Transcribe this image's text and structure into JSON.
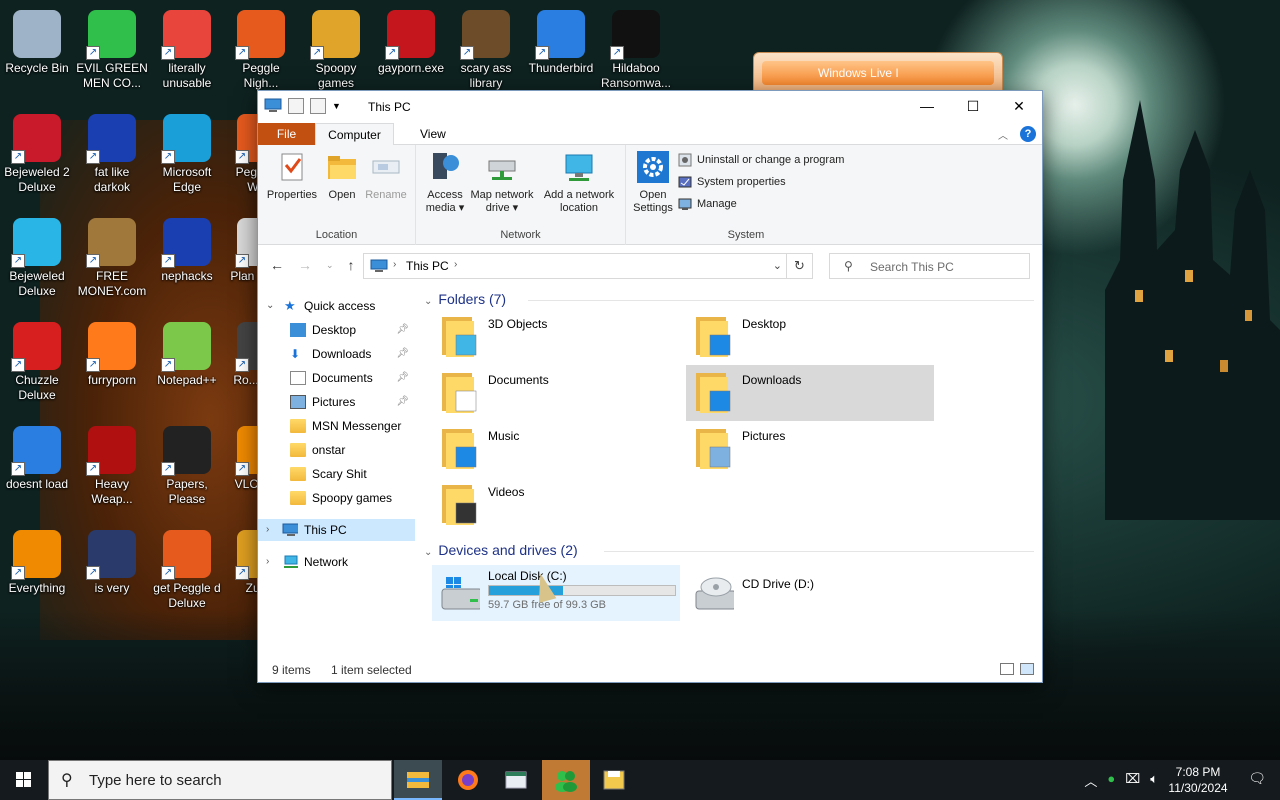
{
  "desktop": {
    "icons": [
      {
        "label": "Recycle Bin",
        "icon": "recycle-bin-icon"
      },
      {
        "label": "EVIL GREEN MEN CO...",
        "icon": "msn-messenger-icon"
      },
      {
        "label": "literally unusable",
        "icon": "chrome-icon"
      },
      {
        "label": "Peggle Nigh...",
        "icon": "peggle-icon"
      },
      {
        "label": "Spoopy games",
        "icon": "folder-icon"
      },
      {
        "label": "gayporn.exe",
        "icon": "flash-icon"
      },
      {
        "label": "scary ass library",
        "icon": "library-icon"
      },
      {
        "label": "Thunderbird",
        "icon": "thunderbird-icon"
      },
      {
        "label": "Hildaboo Ransomwa...",
        "icon": "yashma-icon"
      },
      {
        "label": "Bejeweled 2 Deluxe",
        "icon": "bejeweled2-icon"
      },
      {
        "label": "fat like darkok",
        "icon": "mpi-icon"
      },
      {
        "label": "Microsoft Edge",
        "icon": "edge-icon"
      },
      {
        "label": "Peggle of Wa...",
        "icon": "peggle-icon"
      },
      {
        "label": "Bejeweled Deluxe",
        "icon": "gem-icon"
      },
      {
        "label": "FREE MONEY.com",
        "icon": "money-bag-icon"
      },
      {
        "label": "nephacks",
        "icon": "mpi-icon"
      },
      {
        "label": "Plan Zom...",
        "icon": "flower-icon"
      },
      {
        "label": "Chuzzle Deluxe",
        "icon": "chuzzle-icon"
      },
      {
        "label": "furryporn",
        "icon": "firefox-icon"
      },
      {
        "label": "Notepad++",
        "icon": "notepadpp-icon"
      },
      {
        "label": "Ro... Ma...",
        "icon": "app-icon"
      },
      {
        "label": "doesnt load",
        "icon": "thunderbird-icon"
      },
      {
        "label": "Heavy Weap...",
        "icon": "radiation-icon"
      },
      {
        "label": "Papers, Please",
        "icon": "papers-please-icon"
      },
      {
        "label": "VLC pla...",
        "icon": "vlc-icon"
      },
      {
        "label": "Everything",
        "icon": "everything-search-icon"
      },
      {
        "label": "is very",
        "icon": "mpi-shield-icon"
      },
      {
        "label": "get Peggle d Deluxe",
        "icon": "peggle-icon"
      },
      {
        "label": "Zuma",
        "icon": "zuma-icon"
      }
    ],
    "popup_title": "Windows Live I"
  },
  "window": {
    "title": "This PC",
    "tabs": {
      "file": "File",
      "computer": "Computer",
      "view": "View"
    },
    "ribbon": {
      "location": {
        "label": "Location",
        "properties": "Properties",
        "open": "Open",
        "rename": "Rename"
      },
      "network": {
        "label": "Network",
        "access_media_1": "Access",
        "access_media_2": "media",
        "map_drive_1": "Map network",
        "map_drive_2": "drive",
        "add_location_1": "Add a network",
        "add_location_2": "location"
      },
      "system": {
        "label": "System",
        "open_settings_1": "Open",
        "open_settings_2": "Settings",
        "uninstall": "Uninstall or change a program",
        "system_properties": "System properties",
        "manage": "Manage"
      }
    },
    "address": {
      "path": "This PC",
      "search_placeholder": "Search This PC"
    },
    "nav": {
      "quick_access": "Quick access",
      "items": [
        "Desktop",
        "Downloads",
        "Documents",
        "Pictures",
        "MSN Messenger",
        "onstar",
        "Scary Shit",
        "Spoopy games"
      ],
      "this_pc": "This PC",
      "network": "Network"
    },
    "folders_header": "Folders (7)",
    "folders": [
      "3D Objects",
      "Desktop",
      "Documents",
      "Downloads",
      "Music",
      "Pictures",
      "Videos"
    ],
    "devices_header": "Devices and drives (2)",
    "drives": {
      "c_name": "Local Disk (C:)",
      "c_free": "59.7 GB free of 99.3 GB",
      "c_used_fraction": 0.4,
      "d_name": "CD Drive (D:)"
    },
    "status": {
      "items": "9 items",
      "selected": "1 item selected"
    }
  },
  "taskbar": {
    "search_placeholder": "Type here to search",
    "time": "7:08 PM",
    "date": "11/30/2024"
  }
}
